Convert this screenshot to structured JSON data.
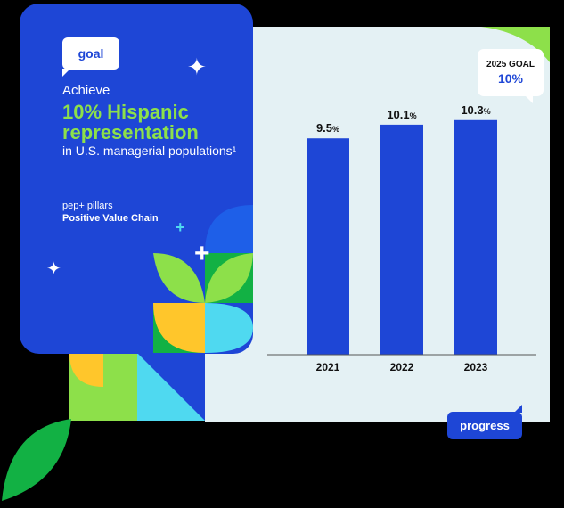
{
  "card": {
    "tag": "goal",
    "lead": "Achieve",
    "headline": "10% Hispanic representation",
    "scope": "in U.S. managerial populations¹",
    "pillars_label": "pep+ pillars",
    "pillar_name": "Positive Value Chain"
  },
  "goal_callout": {
    "label": "2025 GOAL",
    "value": "10%"
  },
  "progress_tag": "progress",
  "colors": {
    "brand_blue": "#1e46d6",
    "green": "#8de04a",
    "panel": "#e4f1f4",
    "cyan": "#4fd9f0",
    "yellow": "#ffc62b",
    "dark_green": "#12b144"
  },
  "icons": [
    "sparkle-icon",
    "plus-icon",
    "leaf-icon"
  ],
  "chart_data": {
    "type": "bar",
    "categories": [
      "2021",
      "2022",
      "2023"
    ],
    "values": [
      9.5,
      10.1,
      10.3
    ],
    "value_labels": [
      "9.5",
      "10.1",
      "10.3"
    ],
    "value_unit": "%",
    "goal_line": 10,
    "title": "",
    "xlabel": "",
    "ylabel": "",
    "ylim": [
      0,
      10.8
    ],
    "grid": false,
    "bar_color": "#1e46d6"
  }
}
